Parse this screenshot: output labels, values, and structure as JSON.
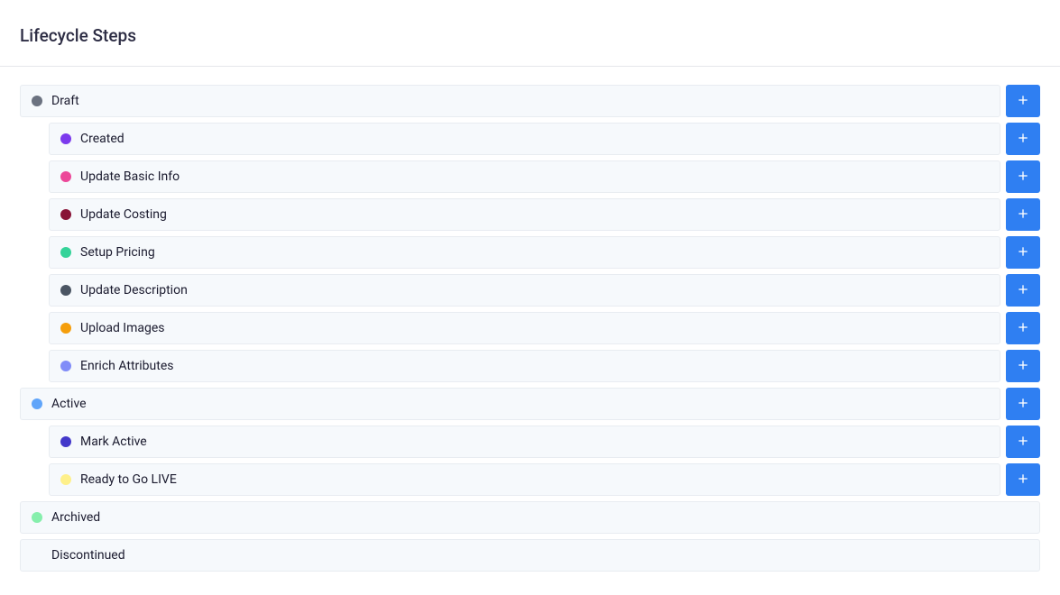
{
  "page_title": "Lifecycle Steps",
  "colors": {
    "accent": "#2f7ff2"
  },
  "groups": [
    {
      "label": "Draft",
      "dot_color": "#6b7280",
      "has_add": true,
      "children": [
        {
          "label": "Created",
          "dot_color": "#7c3aed",
          "has_add": true
        },
        {
          "label": "Update Basic Info",
          "dot_color": "#ec4899",
          "has_add": true
        },
        {
          "label": "Update Costing",
          "dot_color": "#881337",
          "has_add": true
        },
        {
          "label": "Setup Pricing",
          "dot_color": "#34d399",
          "has_add": true
        },
        {
          "label": "Update Description",
          "dot_color": "#4b5563",
          "has_add": true
        },
        {
          "label": "Upload Images",
          "dot_color": "#f59e0b",
          "has_add": true
        },
        {
          "label": "Enrich Attributes",
          "dot_color": "#818cf8",
          "has_add": true
        }
      ]
    },
    {
      "label": "Active",
      "dot_color": "#60a5fa",
      "has_add": true,
      "children": [
        {
          "label": "Mark Active",
          "dot_color": "#4338ca",
          "has_add": true
        },
        {
          "label": "Ready to Go LIVE",
          "dot_color": "#fef08a",
          "has_add": true
        }
      ]
    },
    {
      "label": "Archived",
      "dot_color": "#86efac",
      "has_add": false,
      "children": []
    },
    {
      "label": "Discontinued",
      "dot_color": null,
      "has_add": false,
      "children": []
    }
  ]
}
